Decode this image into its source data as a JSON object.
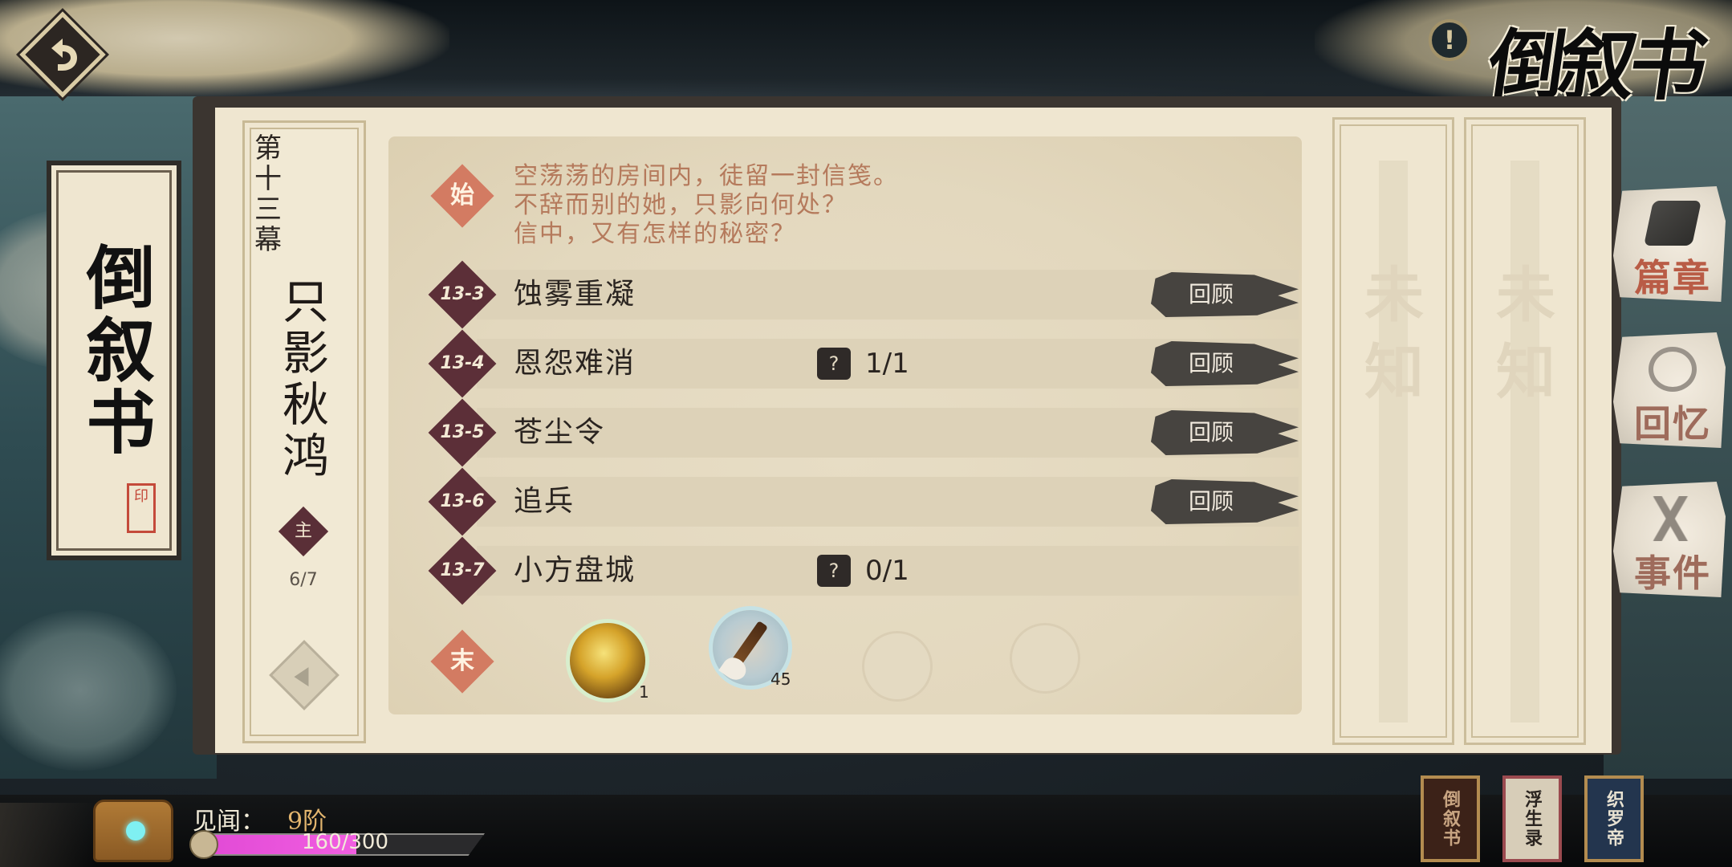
{
  "header": {
    "title": "倒叙书",
    "info_symbol": "!"
  },
  "banner": {
    "title": "倒叙书",
    "seal": "印"
  },
  "chapter": {
    "act": "第十三幕",
    "title": "只影秋鸿",
    "badge": "主",
    "progress": "6/7"
  },
  "intro": {
    "badge": "始",
    "lines": [
      "空荡荡的房间内，徒留一封信笺。",
      "不辞而别的她，只影向何处？",
      "信中，又有怎样的秘密？"
    ]
  },
  "stages": [
    {
      "code": "13-3",
      "name": "蚀雾重凝",
      "quest": "",
      "review": "回顾"
    },
    {
      "code": "13-4",
      "name": "恩怨难消",
      "quest": "1/1",
      "review": "回顾"
    },
    {
      "code": "13-5",
      "name": "苍尘令",
      "quest": "",
      "review": "回顾"
    },
    {
      "code": "13-6",
      "name": "追兵",
      "quest": "",
      "review": "回顾"
    },
    {
      "code": "13-7",
      "name": "小方盘城",
      "quest": "0/1",
      "review": ""
    }
  ],
  "quest_icon": "?",
  "end": {
    "badge": "末",
    "rewards": [
      {
        "icon": "gold-compass-icon",
        "qty": "1"
      },
      {
        "icon": "brush-icon",
        "qty": "45"
      }
    ]
  },
  "locked": {
    "text": "未知"
  },
  "side_tabs": [
    {
      "label": "篇章",
      "icon": "scroll-icon",
      "active": true
    },
    {
      "label": "回忆",
      "icon": "cloud-icon",
      "active": false
    },
    {
      "label": "事件",
      "icon": "blades-icon",
      "active": false
    }
  ],
  "footer": {
    "jianwen_label": "见闻：",
    "jianwen_level": "9阶",
    "exp_text": "160/300",
    "exp_progress": 0.533,
    "books": [
      "倒叙书",
      "浮生录",
      "织罗帝"
    ]
  },
  "colors": {
    "parchment": "#efe6d0",
    "stage_badge": "#5c2f38",
    "start_badge": "#d37b62",
    "tab_label": "#b95c46",
    "exp_fill": "#e24bd6"
  }
}
